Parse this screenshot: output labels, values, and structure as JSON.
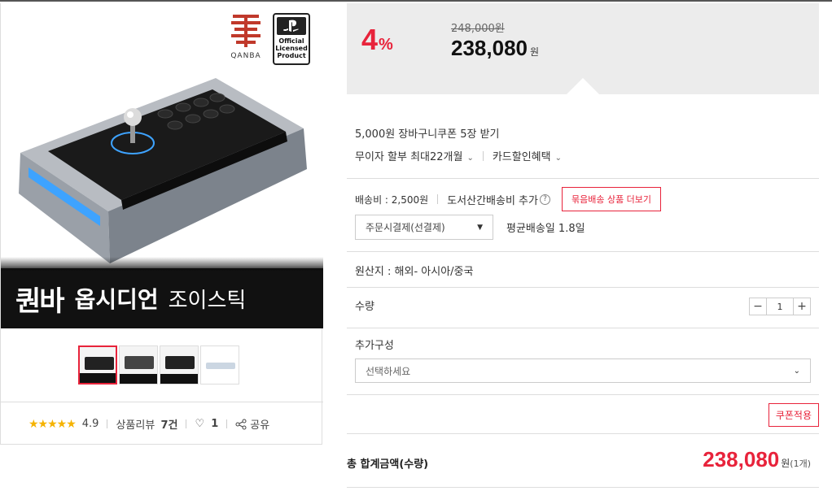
{
  "product": {
    "brand_logo_text": "QANBA",
    "ps_logo_lines": [
      "Official",
      "Licensed",
      "Product"
    ],
    "banner_brand": "퀀바",
    "banner_name": "옵시디언",
    "banner_sub": "조이스틱"
  },
  "rating": {
    "stars": "★★★★★",
    "value": "4.9",
    "review_label": "상품리뷰",
    "review_count": "7건",
    "like_count": "1",
    "share_label": "공유"
  },
  "price": {
    "discount": "4",
    "discount_unit": "%",
    "original": "248,000원",
    "sale": "238,080",
    "sale_unit": "원"
  },
  "benefits": {
    "coupon": "5,000원 장바구니쿠폰 5장 받기",
    "installment": "무이자 할부 최대22개월",
    "card": "카드할인혜택"
  },
  "shipping": {
    "fee": "배송비 : 2,500원",
    "island": "도서산간배송비 추가",
    "bundle_button": "묶음배송 상품 더보기",
    "payment_select": "주문시결제(선결제)",
    "avg_days": "평균배송일 1.8일"
  },
  "origin": "원산지 : 해외- 아시아/중국",
  "quantity": {
    "label": "수량",
    "value": "1",
    "minus": "−",
    "plus": "+"
  },
  "options": {
    "label": "추가구성",
    "placeholder": "선택하세요"
  },
  "coupon_button": "쿠폰적용",
  "total": {
    "label": "총 합계금액(수량)",
    "amount": "238,080",
    "unit": "원",
    "count": "(1개)"
  },
  "colors": {
    "accent_red": "#e8233b",
    "star_yellow": "#f5b301"
  }
}
